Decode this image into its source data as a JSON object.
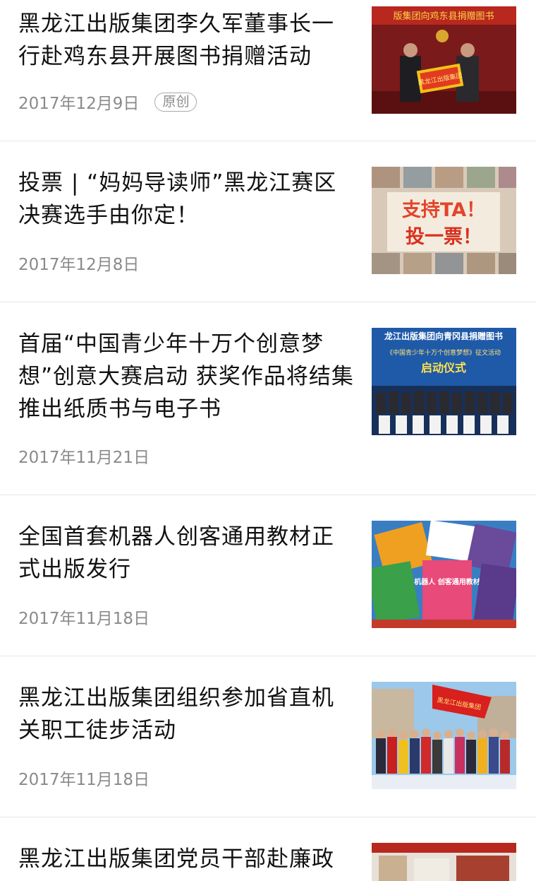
{
  "articles": [
    {
      "title": "黑龙江出版集团李久军董事长一行赴鸡东县开展图书捐赠活动",
      "date": "2017年12月9日",
      "badge": "原创",
      "thumb": {
        "banner_text": "版集团向鸡东县捐赠图书",
        "sign_text": "黑龙江出版集团"
      }
    },
    {
      "title": "投票 | “妈妈导读师”黑龙江赛区决赛选手由你定！",
      "date": "2017年12月8日",
      "thumb": {
        "line1": "支持TA！",
        "line2": "投一票！"
      }
    },
    {
      "title": "首届“中国青少年十万个创意梦想”创意大赛启动 获奖作品将结集推出纸质书与电子书",
      "date": "2017年11月21日",
      "thumb": {
        "line1": "龙江出版集团向青冈县捐赠图书",
        "line2": "《中国青少年十万个创意梦想》征文活动",
        "line3": "启动仪式"
      }
    },
    {
      "title": "全国首套机器人创客通用教材正式出版发行",
      "date": "2017年11月18日",
      "thumb": {
        "book_text": "机器人 创客通用教材"
      }
    },
    {
      "title": "黑龙江出版集团组织参加省直机关职工徒步活动",
      "date": "2017年11月18日",
      "thumb": {
        "flag_text": "黑龙江出版集团"
      }
    },
    {
      "title": "黑龙江出版集团党员干部赴廉政",
      "date": ""
    }
  ]
}
